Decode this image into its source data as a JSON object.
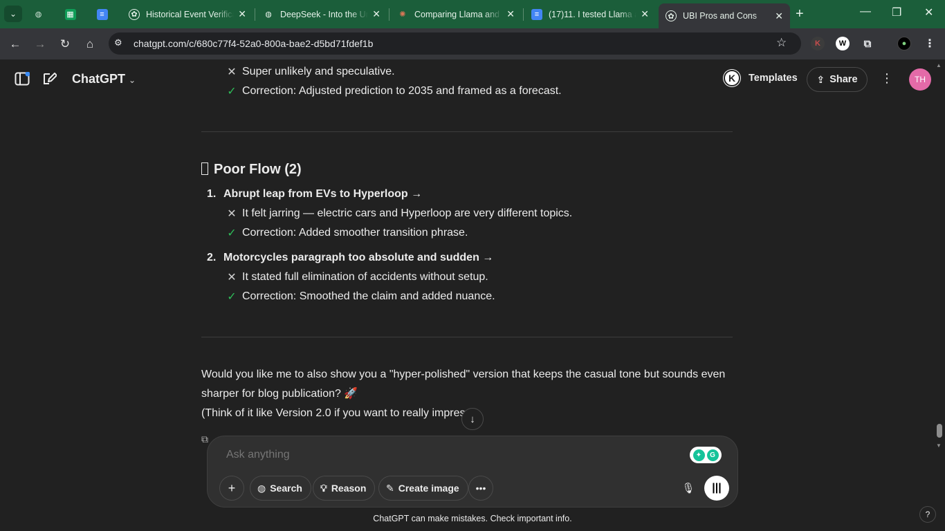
{
  "browser": {
    "tabs": [
      {
        "title": "",
        "icon": "sheets-icon",
        "color": "#0f9d58"
      },
      {
        "title": "",
        "icon": "docs-icon",
        "color": "#4285f4"
      },
      {
        "title": "Historical Event Verifica",
        "icon": "openai-icon"
      },
      {
        "title": "DeepSeek - Into the Un",
        "icon": "globe-icon"
      },
      {
        "title": "Comparing Llama and C",
        "icon": "claude-icon"
      },
      {
        "title": "(17)11. I tested Llama a",
        "icon": "docs-icon"
      },
      {
        "title": "UBI Pros and Cons",
        "icon": "openai-icon",
        "active": true
      }
    ],
    "url": "chatgpt.com/c/680c77f4-52a0-800a-bae2-d5bd71fdef1b"
  },
  "header": {
    "brand": "ChatGPT",
    "templates_label": "Templates",
    "templates_badge": "K",
    "share_label": "Share",
    "avatar_initials": "TH"
  },
  "content": {
    "top_lines": [
      {
        "type": "x",
        "text": "Super unlikely and speculative."
      },
      {
        "type": "ok",
        "text": "Correction: Adjusted prediction to 2035 and framed as a forecast."
      }
    ],
    "section_title": "Poor Flow (2)",
    "items": [
      {
        "num": "1.",
        "title": "Abrupt leap from EVs to Hyperloop →",
        "lines": [
          {
            "type": "x",
            "text": "It felt jarring — electric cars and Hyperloop are very different topics."
          },
          {
            "type": "ok",
            "text": "Correction: Added smoother transition phrase."
          }
        ]
      },
      {
        "num": "2.",
        "title": "Motorcycles paragraph too absolute and sudden →",
        "lines": [
          {
            "type": "x",
            "text": "It stated full elimination of accidents without setup."
          },
          {
            "type": "ok",
            "text": "Correction: Smoothed the claim and added nuance."
          }
        ]
      }
    ],
    "closing_line1": "Would you like me to also show you a \"hyper-polished\" version that keeps the casual tone but sounds even",
    "closing_line2": "sharper for blog publication? 🚀",
    "closing_line3": "(Think of it like Version 2.0 if you want to really impres"
  },
  "composer": {
    "placeholder": "Ask anything",
    "search_label": "Search",
    "reason_label": "Reason",
    "create_image_label": "Create image"
  },
  "footer": {
    "disclaimer": "ChatGPT can make mistakes. Check important info.",
    "help": "?"
  }
}
